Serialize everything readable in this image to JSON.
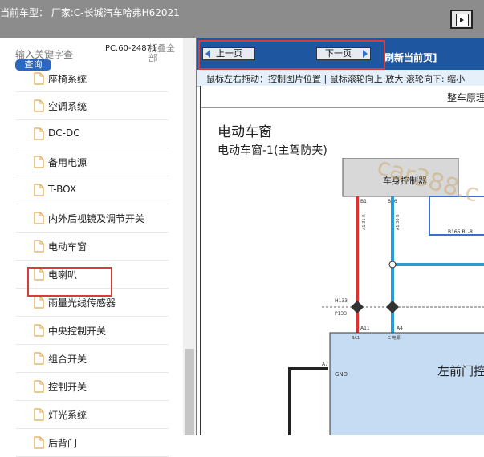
{
  "header": {
    "title": "当前车型： 厂家:C-长城汽车哈弗H62021"
  },
  "sidebar": {
    "search_placeholder": "输入关键字查",
    "search_button": "查询",
    "version": "PC.60-24871",
    "collapse_label": "折叠全部",
    "items": [
      {
        "label": "座椅系统"
      },
      {
        "label": "空调系统"
      },
      {
        "label": "DC-DC"
      },
      {
        "label": "备用电源"
      },
      {
        "label": "T-BOX"
      },
      {
        "label": "内外后视镜及调节开关"
      },
      {
        "label": "电动车窗"
      },
      {
        "label": "电喇叭"
      },
      {
        "label": "雨量光线传感器"
      },
      {
        "label": "中央控制开关"
      },
      {
        "label": "组合开关"
      },
      {
        "label": "控制开关"
      },
      {
        "label": "灯光系统"
      },
      {
        "label": "后背门"
      }
    ],
    "selected_item": "电动车窗"
  },
  "toolbar": {
    "prev_label": "上一页",
    "next_label": "下一页",
    "refresh_label": "刷新当前页]"
  },
  "hint_text": "鼠标左右拖动：控制图片位置 | 鼠标滚轮向上:放大  滚轮向下: 缩小",
  "document": {
    "header": "整车原理",
    "title": "电动车窗",
    "subtitle": "电动车窗-1(主驾防夹)",
    "diagram": {
      "module_top": "车身控制器",
      "watermark": "car388.c",
      "pin_b1": "B1",
      "pin_b16": "B16",
      "wire_left": "A1.31 R",
      "wire_mid": "A1.30 B",
      "connector": "B165 BL-R",
      "node_h133": "H133",
      "node_p133": "P133",
      "pin_a11": "A11",
      "pin_a4": "A4",
      "ba1": "BA1",
      "power_label": "G 电源",
      "pin_a7": "A7",
      "gnd": "GND",
      "module_bottom": "左前门控"
    }
  },
  "colors": {
    "topbar": "#8c8c8c",
    "navbar": "#1e56a0",
    "highlight": "#d83b3b",
    "search_button": "#2a68c2",
    "module_fill": "#c6dcf2",
    "wire_red": "#e03030",
    "wire_blue": "#2d9ad4"
  }
}
